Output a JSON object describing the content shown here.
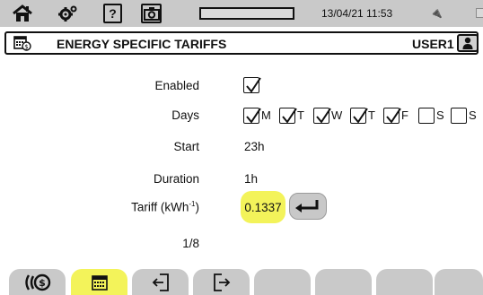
{
  "statusbar": {
    "datetime": "13/04/21 11:53",
    "icons": [
      "home-icon",
      "settings-gear-icon",
      "help-icon",
      "camera-icon",
      "usb-icon",
      "network-icon",
      "battery-icon"
    ]
  },
  "header": {
    "title": "ENERGY SPECIFIC TARIFFS",
    "user": "USER1",
    "icon": "calendar-tariff-icon"
  },
  "form": {
    "enabled": {
      "label": "Enabled",
      "checked": true
    },
    "days": {
      "label": "Days",
      "items": [
        {
          "letter": "M",
          "checked": true
        },
        {
          "letter": "T",
          "checked": true
        },
        {
          "letter": "W",
          "checked": true
        },
        {
          "letter": "T",
          "checked": true
        },
        {
          "letter": "F",
          "checked": true
        },
        {
          "letter": "S",
          "checked": false
        },
        {
          "letter": "S",
          "checked": false
        }
      ]
    },
    "start": {
      "label": "Start",
      "value": "23h"
    },
    "duration": {
      "label": "Duration",
      "value": "1h"
    },
    "tariff": {
      "label_main": "Tariff (kWh",
      "label_sup": "-1",
      "label_end": ")",
      "value": "0.1337"
    },
    "page": "1/8"
  },
  "colors": {
    "highlight": "#f3f35a",
    "bar": "#c9c9c9"
  },
  "tabs": [
    {
      "icon": "energy-cost-icon",
      "active": false
    },
    {
      "icon": "calendar-icon",
      "active": true
    },
    {
      "icon": "import-icon",
      "active": false
    },
    {
      "icon": "export-icon",
      "active": false
    },
    {
      "icon": "",
      "active": false
    },
    {
      "icon": "",
      "active": false
    },
    {
      "icon": "",
      "active": false
    },
    {
      "icon": "",
      "active": false
    }
  ]
}
